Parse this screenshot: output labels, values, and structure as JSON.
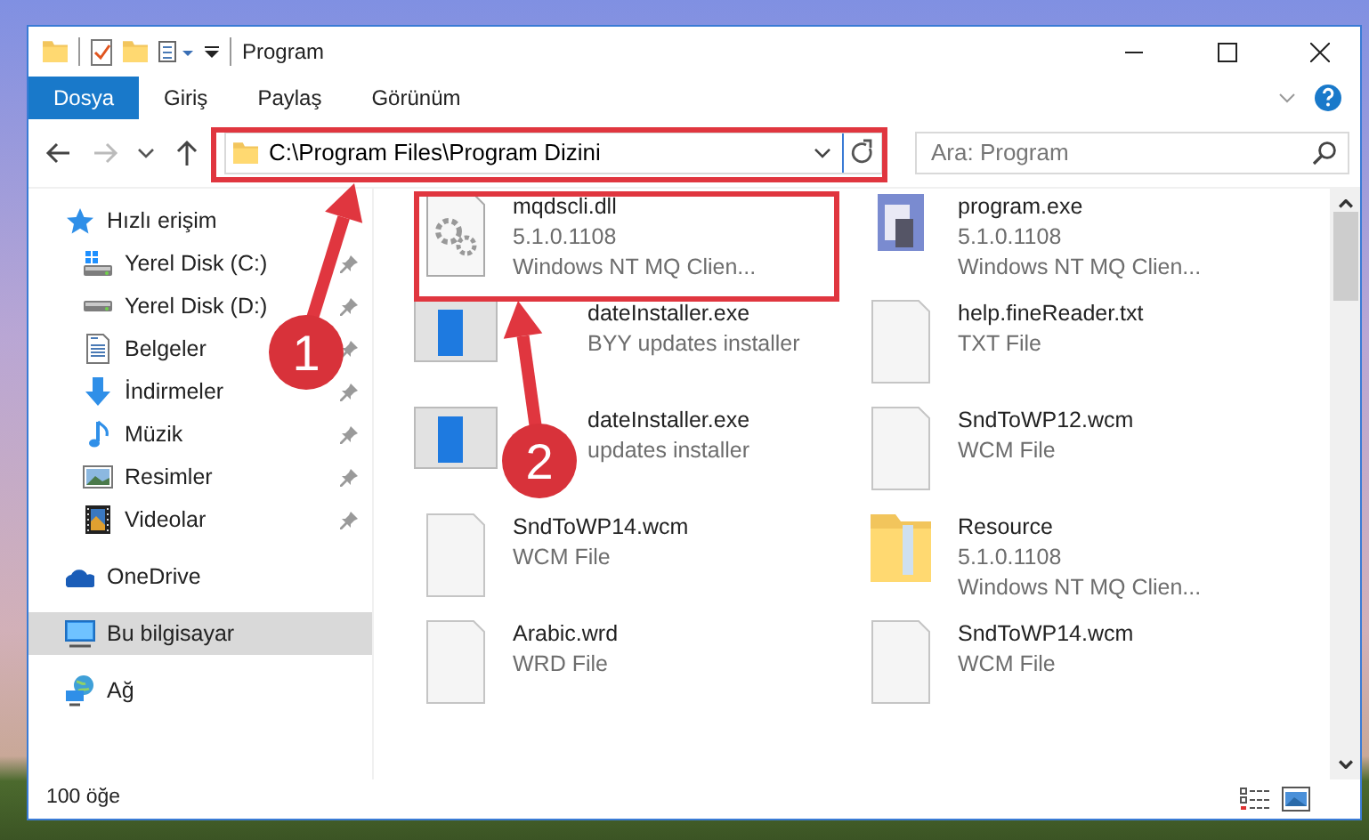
{
  "window": {
    "title": "Program"
  },
  "ribbon_tabs": [
    {
      "label": "Dosya",
      "kind": "file"
    },
    {
      "label": "Giriş",
      "kind": "tab"
    },
    {
      "label": "Paylaş",
      "kind": "tab"
    },
    {
      "label": "Görünüm",
      "kind": "tab"
    }
  ],
  "navigation": {
    "back_disabled": false,
    "forward_disabled": true
  },
  "address_bar": {
    "path": "C:\\Program Files\\Program Dizini"
  },
  "search": {
    "placeholder": "Ara: Program"
  },
  "sidebar": {
    "items": [
      {
        "label": "Hızlı erişim",
        "kind": "star",
        "selected": false,
        "children": [
          {
            "label": "Yerel Disk (C:)",
            "kind": "drive-windows",
            "pinned": true,
            "selected": false
          },
          {
            "label": "Yerel Disk (D:)",
            "kind": "drive",
            "pinned": true,
            "selected": false
          },
          {
            "label": "Belgeler",
            "kind": "documents",
            "pinned": true,
            "selected": false
          },
          {
            "label": "İndirmeler",
            "kind": "download",
            "pinned": true,
            "selected": false
          },
          {
            "label": "Müzik",
            "kind": "music",
            "pinned": true,
            "selected": false
          },
          {
            "label": "Resimler",
            "kind": "pictures",
            "pinned": true,
            "selected": false
          },
          {
            "label": "Videolar",
            "kind": "videos",
            "pinned": true,
            "selected": false
          }
        ]
      },
      {
        "label": "OneDrive",
        "kind": "cloud",
        "selected": false
      },
      {
        "label": "Bu bilgisayar",
        "kind": "computer",
        "selected": true
      },
      {
        "label": "Ağ",
        "kind": "network",
        "selected": false
      }
    ]
  },
  "files": [
    {
      "kind": "dll",
      "name": "mqdscli.dll",
      "lines": [
        "5.1.0.1108",
        "Windows NT MQ Clien..."
      ]
    },
    {
      "kind": "program",
      "name": "program.exe",
      "lines": [
        "5.1.0.1108",
        "Windows NT MQ Clien..."
      ]
    },
    {
      "kind": "installer",
      "name": "dateInstaller.exe",
      "lines": [
        "BYY updates installer"
      ]
    },
    {
      "kind": "text",
      "name": "help.fineReader.txt",
      "lines": [
        "TXT File"
      ]
    },
    {
      "kind": "installer",
      "name": "dateInstaller.exe",
      "lines": [
        "updates installer"
      ]
    },
    {
      "kind": "text",
      "name": "SndToWP12.wcm",
      "lines": [
        "WCM File"
      ]
    },
    {
      "kind": "text",
      "name": "SndToWP14.wcm",
      "lines": [
        "WCM File"
      ]
    },
    {
      "kind": "folder",
      "name": "Resource",
      "lines": [
        "5.1.0.1108",
        "Windows NT MQ Clien..."
      ]
    },
    {
      "kind": "text",
      "name": "Arabic.wrd",
      "lines": [
        "WRD File"
      ]
    },
    {
      "kind": "text",
      "name": "SndToWP14.wcm",
      "lines": [
        "WCM File"
      ]
    }
  ],
  "status_bar": {
    "item_count": "100 öğe"
  },
  "annotations": [
    {
      "number": "1"
    },
    {
      "number": "2"
    }
  ]
}
